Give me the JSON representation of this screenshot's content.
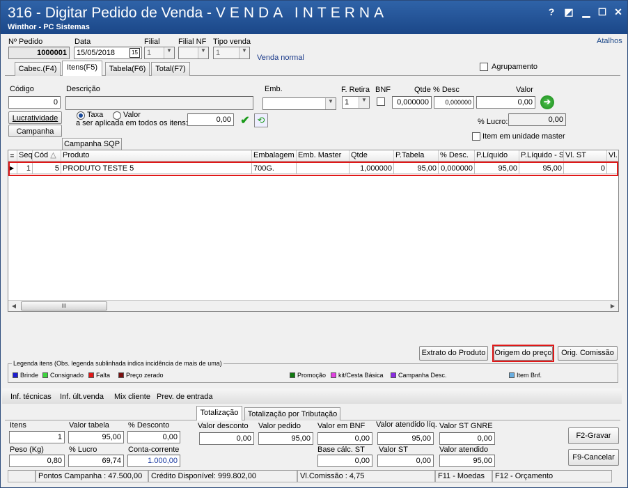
{
  "window": {
    "title_prefix": "316 - Digitar Pedido de Venda - ",
    "title_suffix": "VENDA INTERNA",
    "subtitle": "Winthor - PC Sistemas",
    "buttons": [
      "?",
      "◩",
      "▁",
      "☐",
      "✕"
    ]
  },
  "atalhos": "Atalhos",
  "header": {
    "num_pedido_label": "Nº Pedido",
    "num_pedido": "1000001",
    "data_label": "Data",
    "data": "15/05/2018",
    "cal": "15",
    "filial_label": "Filial",
    "filial": "1",
    "filial_nf_label": "Filial NF",
    "tipo_venda_label": "Tipo venda",
    "tipo_venda": "1",
    "venda_normal": "Venda normal"
  },
  "tabs": [
    "Cabec.(F4)",
    "Itens(F5)",
    "Tabela(F6)",
    "Total(F7)"
  ],
  "agrupamento": "Agrupamento",
  "itens": {
    "codigo_label": "Código",
    "codigo": "0",
    "descricao_label": "Descrição",
    "emb_label": "Emb.",
    "fretira_label": "F. Retira",
    "fretira": "1",
    "bnf_label": "BNF",
    "qtde_label": "Qtde",
    "qtde": "0,000000",
    "pdesc_label": "% Desc",
    "pdesc": "0,000000",
    "valor_label": "Valor",
    "valor": "0,00",
    "lucratividade": "Lucratividade",
    "campanha": "Campanha",
    "taxa": "Taxa",
    "valor_radio": "Valor",
    "aplicar_label": "a ser aplicada em todos os itens:",
    "aplicar": "0,00",
    "plucro_label": "% Lucro:",
    "plucro": "0,00",
    "item_master": "Item em unidade master",
    "campanha_sqp": "Campanha SQP"
  },
  "grid": {
    "columns": [
      "Seq",
      "Cód",
      "Produto",
      "Embalagem",
      "Emb. Master",
      "Qtde",
      "P.Tabela",
      "% Desc.",
      "P.Líquido",
      "P.Líquido - S",
      "Vl. ST",
      "Vl."
    ],
    "rows": [
      [
        "1",
        "5",
        "PRODUTO TESTE 5",
        "700G.",
        "",
        "1,000000",
        "95,00",
        "0,000000",
        "95,00",
        "95,00",
        "0"
      ]
    ],
    "hscroll": "III"
  },
  "actions": {
    "extrato": "Extrato do Produto",
    "origem": "Origem do preço",
    "orig_comissao": "Orig. Comissão"
  },
  "legenda": {
    "title": "Legenda itens (Obs. legenda sublinhada indica incidência de mais de uma)",
    "items": [
      {
        "label": "Brinde",
        "color": "#1c1cd0"
      },
      {
        "label": "Consignado",
        "color": "#3ed43e"
      },
      {
        "label": "Falta",
        "color": "#e01818"
      },
      {
        "label": "Preço zerado",
        "color": "#7a1010"
      },
      {
        "label": "Promoção",
        "color": "#107a10"
      },
      {
        "label": "kit/Cesta Básica",
        "color": "#e040e0"
      },
      {
        "label": "Campanha Desc.",
        "color": "#8a2be2"
      },
      {
        "label": "Item Bnf.",
        "color": "#6aaee0"
      }
    ]
  },
  "links": [
    "Inf. técnicas",
    "Inf. últ.venda",
    "Mix cliente",
    "Prev. de entrada"
  ],
  "tot_tabs": [
    "Totalização",
    "Totalização por Tributação"
  ],
  "totals": {
    "itens_label": "Itens",
    "itens": "1",
    "valor_tabela_label": "Valor tabela",
    "valor_tabela": "95,00",
    "pdesconto_label": "% Desconto",
    "pdesconto": "0,00",
    "valor_desconto_label": "Valor desconto",
    "valor_desconto": "0,00",
    "valor_pedido_label": "Valor pedido",
    "valor_pedido": "95,00",
    "valor_bnf_label": "Valor em BNF",
    "valor_bnf": "0,00",
    "valor_atendido_liq_label": "Valor atendido líq.",
    "valor_atendido_liq": "95,00",
    "valor_st_gnre_label": "Valor ST GNRE",
    "valor_st_gnre": "0,00",
    "peso_label": "Peso (Kg)",
    "peso": "0,80",
    "plucro_label": "% Lucro",
    "plucro": "69,74",
    "conta_corrente_label": "Conta-corrente",
    "conta_corrente": "1.000,00",
    "base_st_label": "Base cálc. ST",
    "base_st": "0,00",
    "valor_st_label": "Valor ST",
    "valor_st": "0,00",
    "valor_atendido_label": "Valor atendido",
    "valor_atendido": "95,00"
  },
  "buttons": {
    "gravar": "F2-Gravar",
    "cancelar": "F9-Cancelar"
  },
  "status": [
    "Pontos Campanha : 47.500,00",
    "Crédito Disponível: 999.802,00",
    "Vl.Comissão : 4,75",
    "F11 - Moedas",
    "F12 - Orçamento"
  ]
}
